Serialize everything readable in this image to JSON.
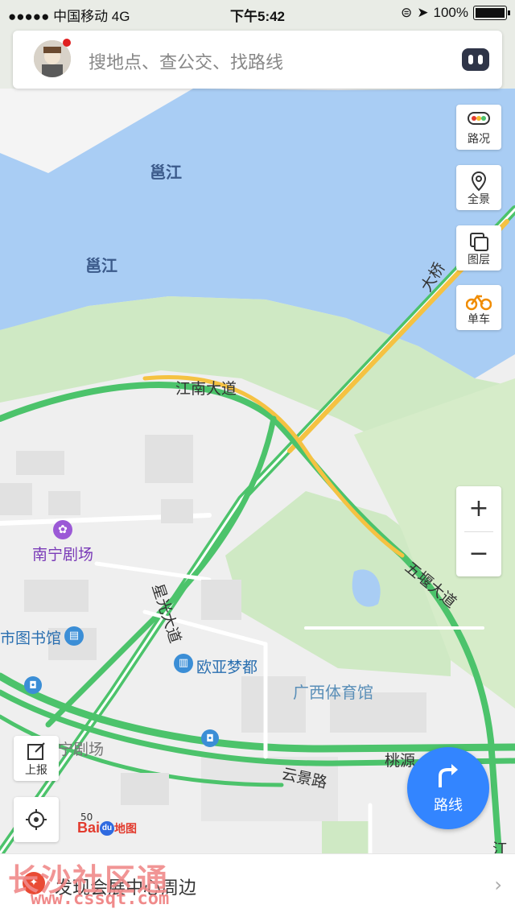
{
  "status_bar": {
    "carrier": "●●●●● 中国移动   4G",
    "time": "下午5:42",
    "battery": "100%"
  },
  "search": {
    "placeholder": "搜地点、查公交、找路线"
  },
  "side_buttons": {
    "traffic": "路况",
    "panorama": "全景",
    "layers": "图层",
    "bike": "单车"
  },
  "left_buttons": {
    "report": "上报"
  },
  "route_button": "路线",
  "map_labels": {
    "river1": "邕江",
    "river2": "邕江",
    "bridge": "大桥",
    "road_jiangnan": "江南大道",
    "road_xingguang": "星光大道",
    "road_wuxu": "五堰大道",
    "road_yunjing": "云景路",
    "road_taoyuan": "桃源",
    "theatre": "南宁剧场",
    "library": "市图书馆",
    "ouya": "欧亚梦都",
    "stadium": "广西体育馆",
    "theatre2": "宁剧场",
    "right_edge": "江"
  },
  "scale": "50",
  "logo": {
    "text": "Bai",
    "suffix": "地图"
  },
  "bottom_bar": {
    "text": "发现会展中心周边"
  },
  "watermark": {
    "title": "长沙社区通",
    "url": "www.cssqt.com"
  },
  "colors": {
    "water": "#a9cdf4",
    "green": "#c8e6c0",
    "road_green": "#4cc36b",
    "road_yellow": "#f5c242",
    "accent": "#3385ff"
  }
}
